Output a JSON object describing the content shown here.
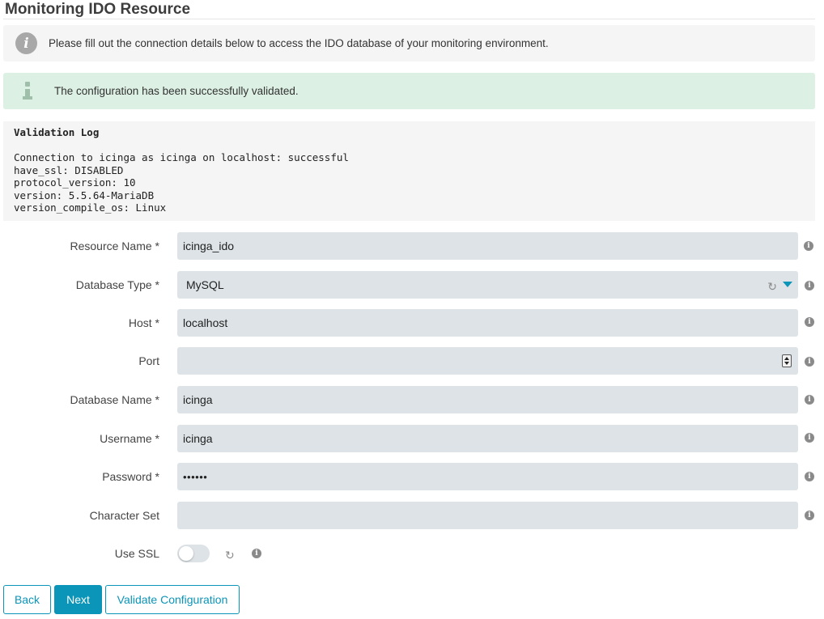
{
  "page": {
    "title": "Monitoring IDO Resource"
  },
  "notices": {
    "info": "Please fill out the connection details below to access the IDO database of your monitoring environment.",
    "success": "The configuration has been successfully validated."
  },
  "validation_log": {
    "title": "Validation Log",
    "lines": [
      "Connection to icinga as icinga on localhost: successful",
      "have_ssl: DISABLED",
      "protocol_version: 10",
      "version: 5.5.64-MariaDB",
      "version_compile_os: Linux"
    ]
  },
  "form": {
    "resource_name": {
      "label": "Resource Name *",
      "value": "icinga_ido"
    },
    "database_type": {
      "label": "Database Type *",
      "value": "MySQL"
    },
    "host": {
      "label": "Host *",
      "value": "localhost"
    },
    "port": {
      "label": "Port",
      "value": ""
    },
    "database_name": {
      "label": "Database Name *",
      "value": "icinga"
    },
    "username": {
      "label": "Username *",
      "value": "icinga"
    },
    "password": {
      "label": "Password *",
      "value": "••••••"
    },
    "character_set": {
      "label": "Character Set",
      "value": ""
    },
    "use_ssl": {
      "label": "Use SSL",
      "checked": false
    }
  },
  "buttons": {
    "back": "Back",
    "next": "Next",
    "validate": "Validate Configuration"
  },
  "icons": {
    "info": "i",
    "help": "i",
    "refresh": "↻"
  },
  "colors": {
    "accent": "#0b95b8",
    "success_bg": "#dcf0e4",
    "input_bg": "#dde3e6",
    "panel_bg": "#f5f5f5"
  }
}
